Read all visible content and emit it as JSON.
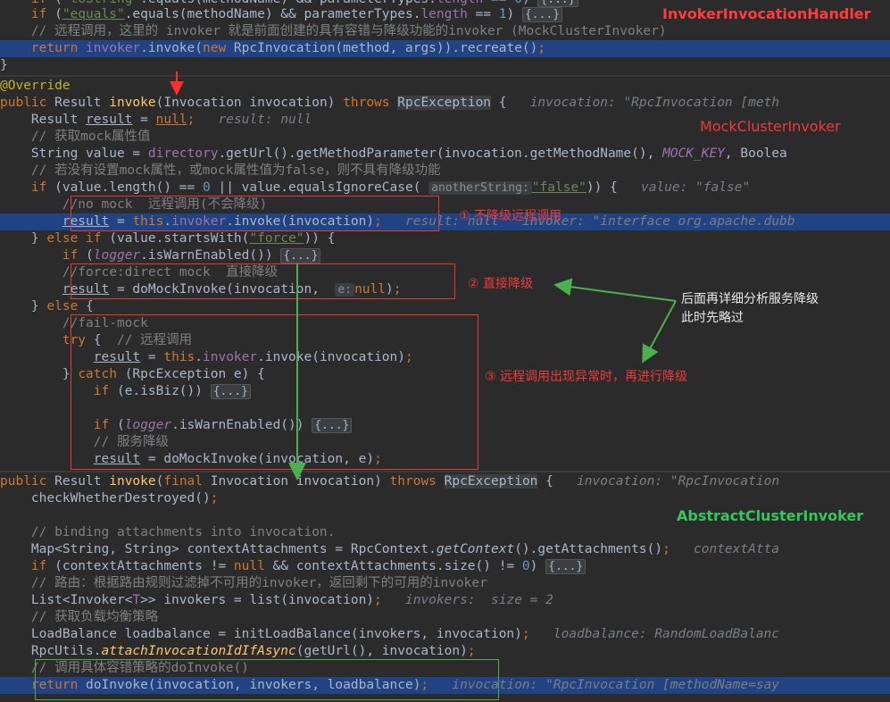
{
  "labels": {
    "invoker_handler": "InvokerInvocationHandler",
    "mock_cluster": "MockClusterInvoker",
    "abstract_cluster": "AbstractClusterInvoker",
    "step1": "① 不降级远程调用",
    "step2": "② 直接降级",
    "step3": "③ 远程调用出现异常时，再进行降级",
    "note_line1": "后面再详细分析服务降级",
    "note_line2": "此时先略过"
  },
  "hints": {
    "h1": "invocation: \"RpcInvocation [meth",
    "h2": "result: null",
    "h3": "value: \"false\"",
    "h4": "result: null   invoker: \"interface org.apache.dubb",
    "h5": "invocation: \"RpcInvocation",
    "h6": "contextAtta",
    "h7": "invokers:  size = 2",
    "h8": "loadbalance: RandomLoadBalanc",
    "h9": "invocation: \"RpcInvocation [methodName=say"
  },
  "params": {
    "another_string": "anotherString:",
    "e": "e:"
  },
  "fold": "{...}",
  "colors": {
    "background": "#2b2b2b",
    "selection": "#214283",
    "keyword": "#cc7832",
    "string": "#6a8759",
    "comment": "#808080",
    "annotation_red": "#ef3a3a",
    "annotation_green": "#34c759"
  }
}
